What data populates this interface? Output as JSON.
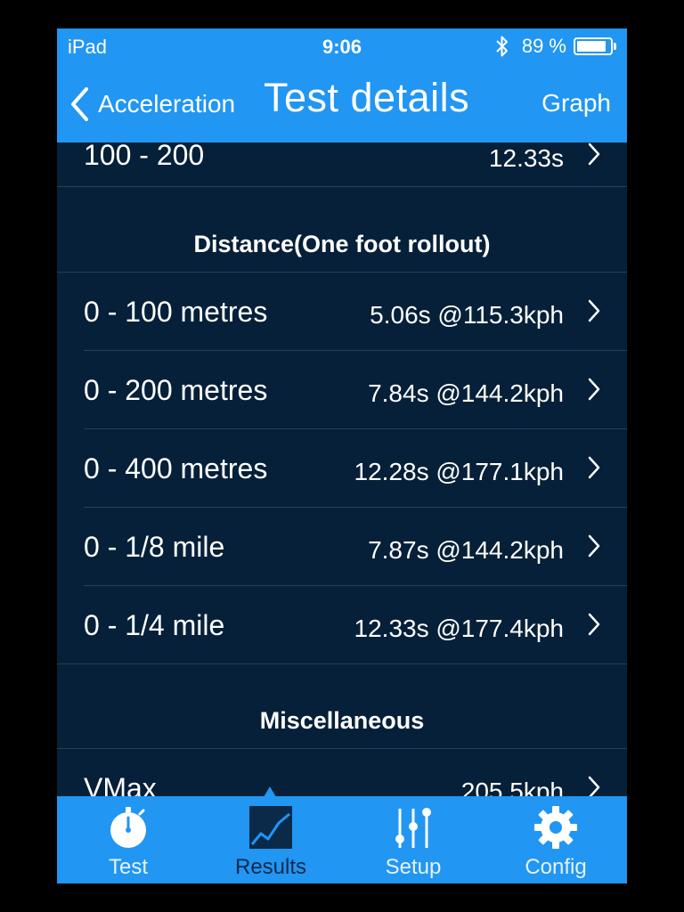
{
  "status_bar": {
    "carrier": "iPad",
    "time": "9:06",
    "battery_percent": "89 %",
    "battery_level": 0.89
  },
  "nav": {
    "back_label": "Acceleration",
    "title": "Test details",
    "right_label": "Graph"
  },
  "top_row": {
    "label": "100 - 200",
    "value": "12.33s"
  },
  "sections": [
    {
      "header": "Distance(One foot rollout)",
      "rows": [
        {
          "label": "0 - 100 metres",
          "value": "5.06s @115.3kph"
        },
        {
          "label": "0 - 200 metres",
          "value": "7.84s @144.2kph"
        },
        {
          "label": "0 - 400 metres",
          "value": "12.28s @177.1kph"
        },
        {
          "label": "0 - 1/8 mile",
          "value": "7.87s @144.2kph"
        },
        {
          "label": "0 - 1/4 mile",
          "value": "12.33s @177.4kph"
        }
      ]
    },
    {
      "header": "Miscellaneous",
      "rows": [
        {
          "label": "VMax",
          "value": "205.5kph"
        }
      ]
    }
  ],
  "tabs": [
    {
      "label": "Test",
      "icon": "stopwatch-icon",
      "selected": false
    },
    {
      "label": "Results",
      "icon": "line-chart-icon",
      "selected": true
    },
    {
      "label": "Setup",
      "icon": "sliders-icon",
      "selected": false
    },
    {
      "label": "Config",
      "icon": "gear-icon",
      "selected": false
    }
  ],
  "colors": {
    "accent": "#2196f3",
    "background": "#052038",
    "separator": "#2b3f53",
    "selected_tab": "#0b2a4a"
  }
}
